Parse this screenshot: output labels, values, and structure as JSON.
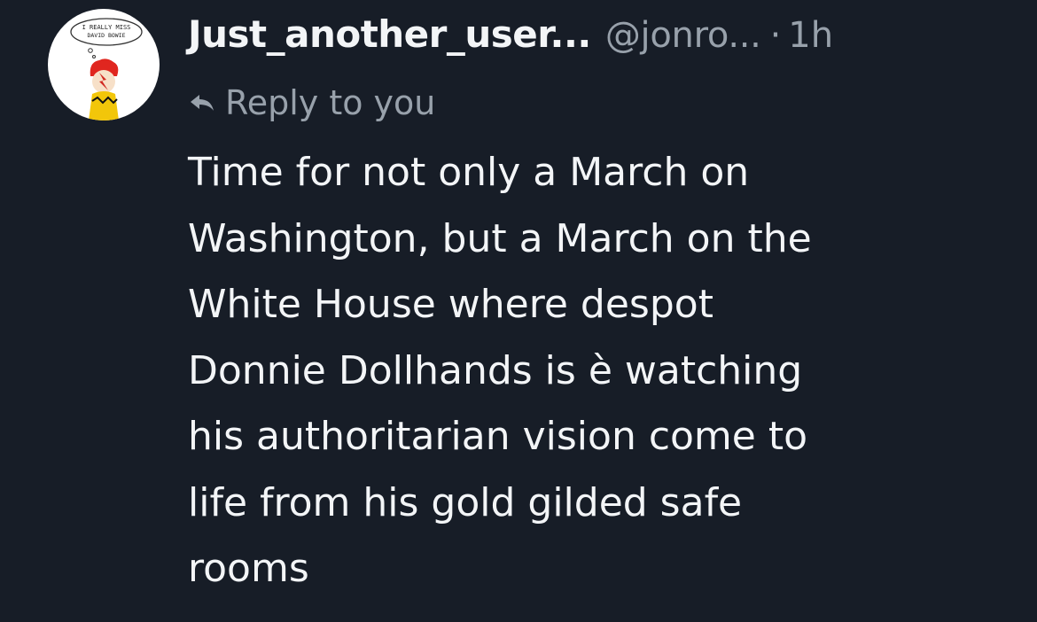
{
  "post": {
    "avatar": {
      "thought_bubble_text": "I REALLY MISS DAVID BOWIE",
      "icon": "avatar-cartoon-icon"
    },
    "author": {
      "display_name": "Just_another_user...",
      "handle": "@jonro...",
      "separator": "·",
      "timestamp": "1h"
    },
    "reply_context": {
      "icon": "reply-arrow-icon",
      "label": "Reply to you"
    },
    "body_lines": [
      "Time for not only a March on",
      "Washington, but a March on the",
      "White House where despot",
      "Donnie Dollhands is è watching",
      "his authoritarian vision come to",
      "life from his gold gilded safe",
      "rooms"
    ]
  },
  "colors": {
    "background": "#171d27",
    "primary_text": "#f3f5f7",
    "secondary_text": "#98a1ab"
  }
}
